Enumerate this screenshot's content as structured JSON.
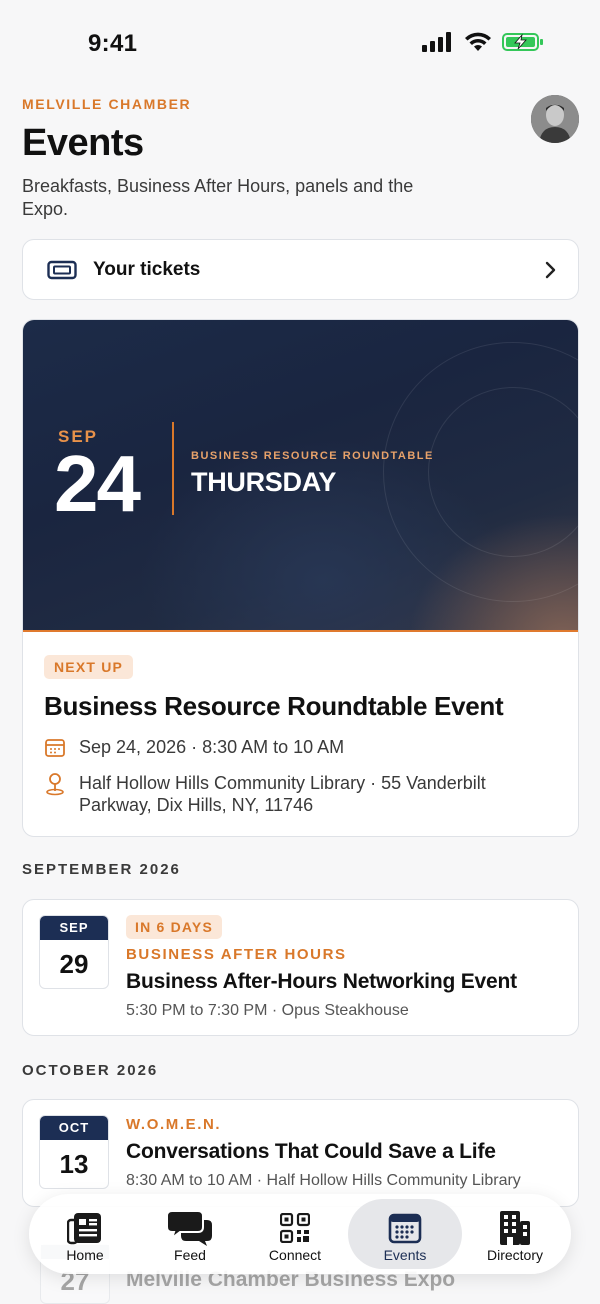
{
  "status_bar": {
    "time": "9:41"
  },
  "header": {
    "org": "MELVILLE CHAMBER",
    "title": "Events",
    "subtitle": "Breakfasts, Business After Hours, panels and the Expo."
  },
  "tickets": {
    "label": "Your tickets"
  },
  "featured": {
    "hero_month": "SEP",
    "hero_day": "24",
    "hero_kicker": "BUSINESS RESOURCE ROUNDTABLE",
    "hero_weekday": "THURSDAY",
    "badge": "NEXT UP",
    "title": "Business Resource Roundtable Event",
    "datetime": "Sep 24, 2026 · 8:30 AM to 10 AM",
    "location": "Half Hollow Hills Community Library · 55 Vanderbilt Parkway, Dix Hills, NY, 11746"
  },
  "sections": [
    {
      "header": "SEPTEMBER 2026",
      "events": [
        {
          "month": "SEP",
          "day": "29",
          "badge": "IN 6 DAYS",
          "category": "BUSINESS AFTER HOURS",
          "title": "Business After-Hours Networking Event",
          "meta": "5:30 PM to 7:30 PM · Opus Steakhouse"
        }
      ]
    },
    {
      "header": "OCTOBER 2026",
      "events": [
        {
          "month": "OCT",
          "day": "13",
          "category": "W.O.M.E.N.",
          "title": "Conversations That Could Save a Life",
          "meta": "8:30 AM to 10 AM · Half Hollow Hills Community Library"
        },
        {
          "day": "27",
          "title": "Melville Chamber Business Expo"
        }
      ]
    }
  ],
  "tab_bar": {
    "tabs": [
      {
        "label": "Home",
        "icon": "newspaper-icon"
      },
      {
        "label": "Feed",
        "icon": "chat-bubbles-icon"
      },
      {
        "label": "Connect",
        "icon": "qr-code-icon"
      },
      {
        "label": "Events",
        "icon": "calendar-icon",
        "active": true
      },
      {
        "label": "Directory",
        "icon": "building-icon"
      }
    ]
  },
  "colors": {
    "accent": "#d9782a",
    "navy": "#1c2e54",
    "badge_bg": "#fbe7d8"
  }
}
